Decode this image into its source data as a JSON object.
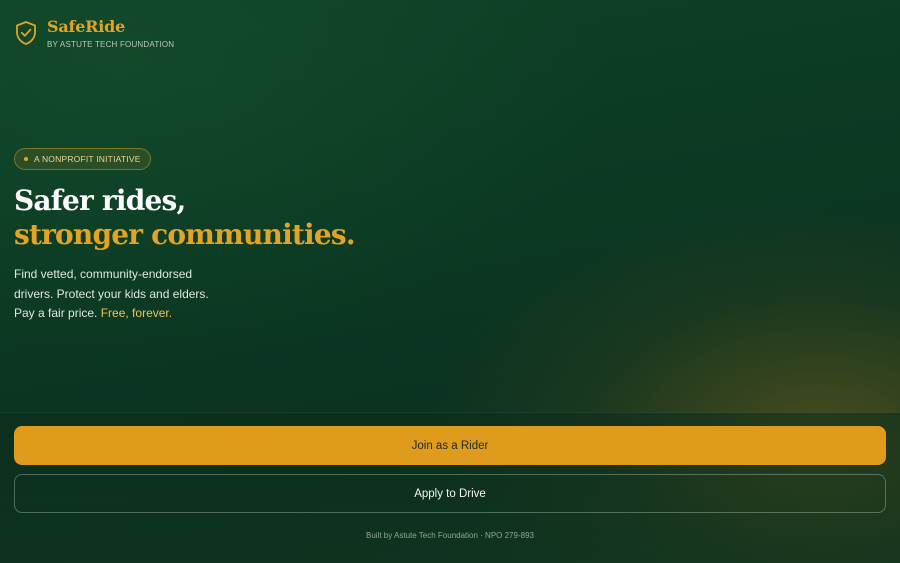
{
  "brand": {
    "icon": "shield-check-icon",
    "name": "SafeRide",
    "subtitle": "BY ASTUTE TECH FOUNDATION"
  },
  "hero": {
    "badge": "A NONPROFIT INITIATIVE",
    "headline_line1": "Safer rides,",
    "headline_line2": "stronger communities.",
    "description": "Find vetted, community-endorsed drivers. Protect your kids and elders. Pay a fair price.",
    "description_accent": "Free, forever."
  },
  "actions": {
    "primary_label": "Join as a Rider",
    "secondary_label": "Apply to Drive"
  },
  "footer": {
    "text": "Built by Astute Tech Foundation · NPO 279-893"
  },
  "colors": {
    "background": "#0c3a23",
    "accent": "#e3a324",
    "primary_button": "#de9b1c"
  }
}
